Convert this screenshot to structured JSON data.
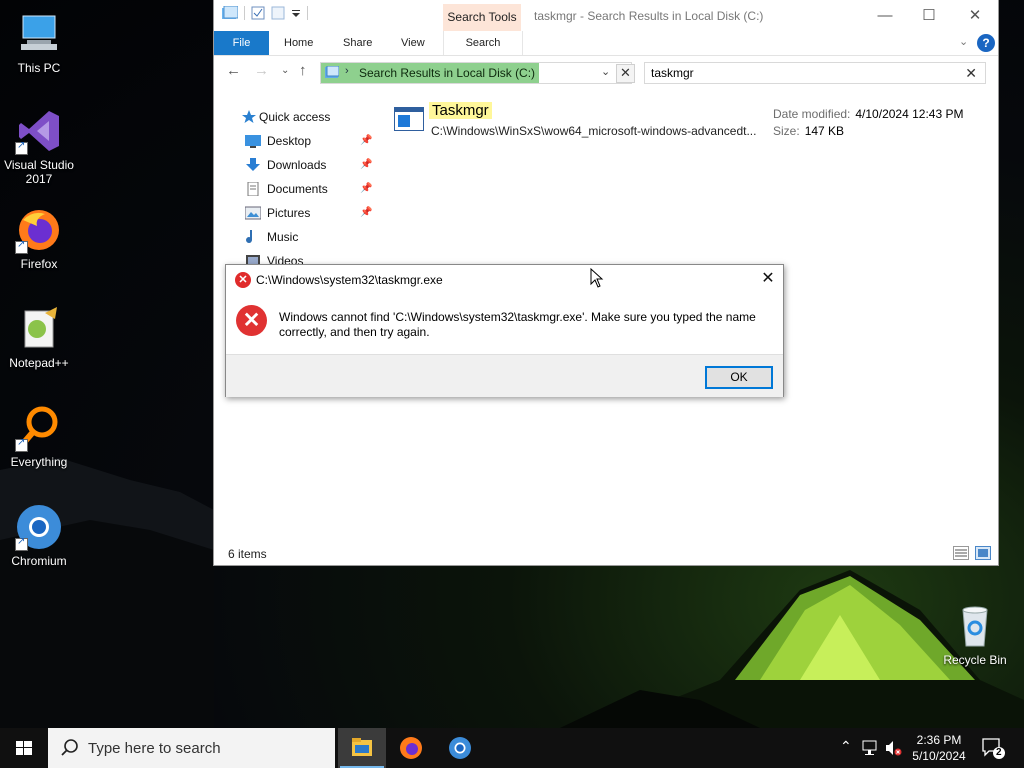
{
  "desktop": {
    "icons": [
      {
        "label": "This PC"
      },
      {
        "label": "Visual Studio 2017"
      },
      {
        "label": "Firefox"
      },
      {
        "label": "Notepad++"
      },
      {
        "label": "Everything"
      },
      {
        "label": "Chromium"
      },
      {
        "label": "Recycle Bin"
      }
    ]
  },
  "explorer": {
    "title": "taskmgr - Search Results in Local Disk (C:)",
    "contextual_tab": "Search Tools",
    "ribbon_tabs": [
      "File",
      "Home",
      "Share",
      "View",
      "Search"
    ],
    "help_label": "?",
    "address": "Search Results in Local Disk (C:)",
    "search_value": "taskmgr",
    "nav": [
      {
        "label": "Quick access",
        "pinned": false
      },
      {
        "label": "Desktop",
        "pinned": true
      },
      {
        "label": "Downloads",
        "pinned": true
      },
      {
        "label": "Documents",
        "pinned": true
      },
      {
        "label": "Pictures",
        "pinned": true
      },
      {
        "label": "Music",
        "pinned": false
      },
      {
        "label": "Videos",
        "pinned": false
      }
    ],
    "result": {
      "name": "Taskmgr",
      "path": "C:\\Windows\\WinSxS\\wow64_microsoft-windows-advancedt...",
      "date_label": "Date modified:",
      "date_value": "4/10/2024 12:43 PM",
      "size_label": "Size:",
      "size_value": "147 KB"
    },
    "status": "6 items"
  },
  "dialog": {
    "title": "C:\\Windows\\system32\\taskmgr.exe",
    "message": "Windows cannot find 'C:\\Windows\\system32\\taskmgr.exe'. Make sure you typed the name correctly, and then try again.",
    "ok": "OK",
    "icon": "error-icon"
  },
  "taskbar": {
    "search_placeholder": "Type here to search",
    "time": "2:36 PM",
    "date": "5/10/2024",
    "notification_count": "2"
  },
  "colors": {
    "accent": "#1979ca",
    "address_highlight": "#8ed08e",
    "search_highlight": "#fff79a",
    "error": "#e02b2b",
    "contextual_tab": "#fde5d8"
  }
}
